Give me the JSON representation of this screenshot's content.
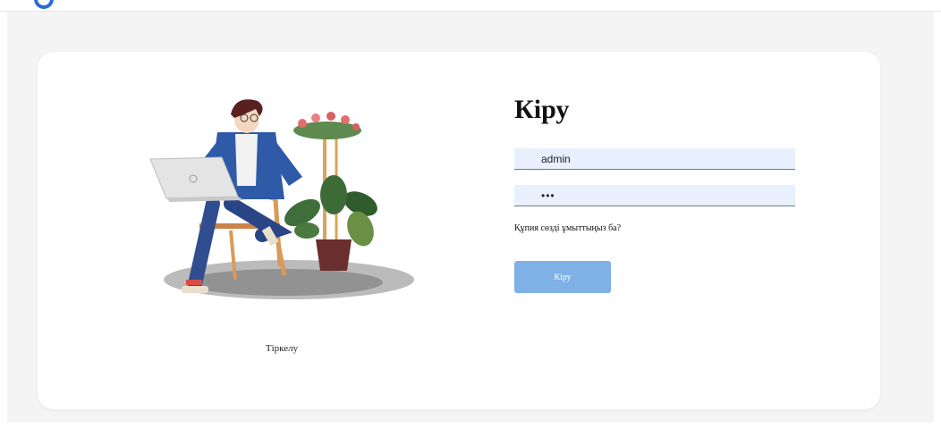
{
  "login": {
    "title": "Кіру",
    "username_value": "admin",
    "password_value": "•••",
    "forgot_password": "Құпия сөзді ұмыттыңыз ба?",
    "submit_label": "Кіру",
    "register_link": "Тіркелу"
  },
  "colors": {
    "accent": "#7fb0e6",
    "field_bg": "#e8f0fe",
    "logo": "#2b6cd4"
  }
}
